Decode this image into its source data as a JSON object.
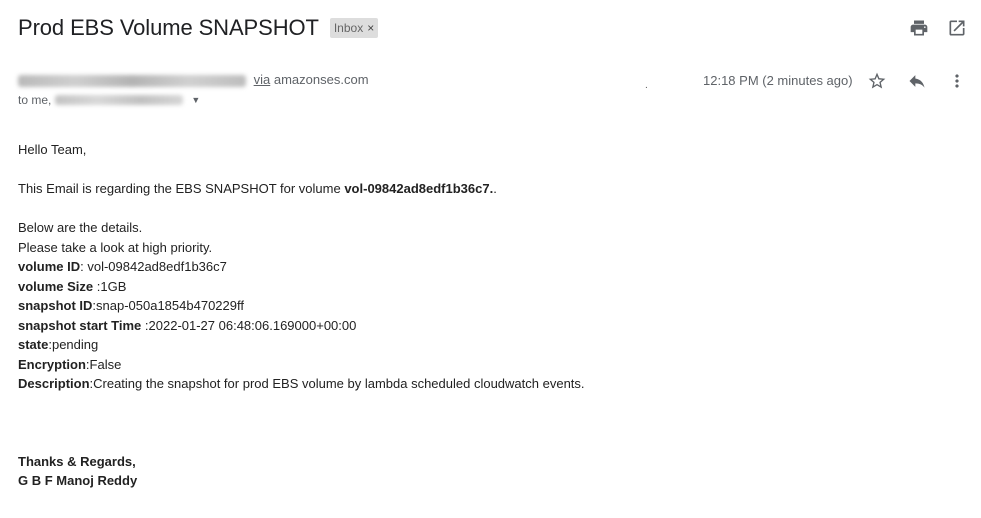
{
  "subject": "Prod EBS Volume SNAPSHOT",
  "label": {
    "text": "Inbox",
    "close": "×"
  },
  "sender": {
    "via_word": "via",
    "via_domain": "amazonses.com",
    "to_prefix": "to me,"
  },
  "time": "12:18 PM (2 minutes ago)",
  "stray_mark": ".",
  "icons": {
    "print": "print-icon",
    "popout": "open-in-new-window-icon",
    "star": "star-icon",
    "reply": "reply-icon",
    "more": "more-vert-icon",
    "expand": "chevron-down-icon"
  },
  "body": {
    "greeting": "Hello Team,",
    "intro_prefix": "This Email is regarding the EBS SNAPSHOT for volume ",
    "intro_volume": "vol-09842ad8edf1b36c7.",
    "intro_suffix": ".",
    "details_line": "Below are the details.",
    "priority_line": "Please take a look at high priority.",
    "fields": [
      {
        "label": "volume ID",
        "value": ": vol-09842ad8edf1b36c7"
      },
      {
        "label": "volume Size",
        "value": " :1GB"
      },
      {
        "label": "snapshot ID",
        "value": ":snap-050a1854b470229ff"
      },
      {
        "label": "snapshot start Time",
        "value": " :2022-01-27 06:48:06.169000+00:00"
      },
      {
        "label": "state",
        "value": ":pending"
      },
      {
        "label": "Encryption",
        "value": ":False"
      },
      {
        "label": "Description",
        "value": ":Creating the snapshot for prod EBS volume by lambda scheduled cloudwatch events."
      }
    ],
    "closing": "Thanks & Regards,",
    "signature": "G B F Manoj Reddy"
  }
}
